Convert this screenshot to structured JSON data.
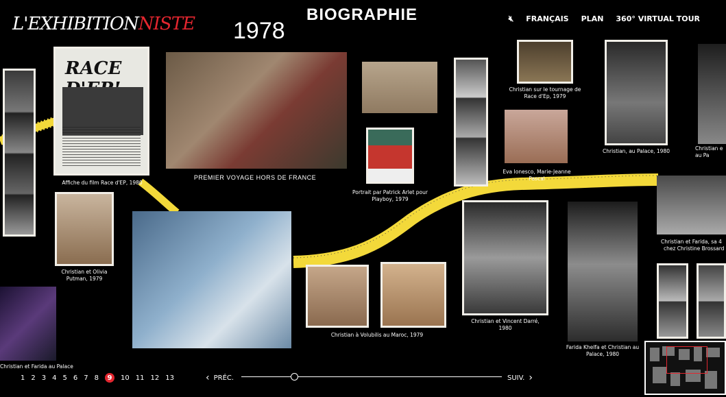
{
  "logo": {
    "text_main": "L'EXHIBITION",
    "text_accent": "NISTE"
  },
  "page_title": "BIOGRAPHIE",
  "year": "1978",
  "nav": {
    "language": "FRANÇAIS",
    "map": "PLAN",
    "virtual_tour": "360° VIRTUAL TOUR",
    "mute_icon": "speaker-mute-icon"
  },
  "poster": {
    "title": "RACE D'EP!"
  },
  "captions": {
    "affiche": "Affiche du film Race d'EP, 1980",
    "premier_voyage": "PREMIER VOYAGE HORS DE FRANCE",
    "portrait_arlet": "Portrait par Patrick Arlet pour Playboy, 1979",
    "tournage": "Christian sur le tournage de Race d'Ep, 1979",
    "palace_1980": "Christian, au Palace, 1980",
    "christian_e": "Christian e au Pa",
    "eva_ionesco": "Eva Ionesco, Marie-Jeanne Pascal",
    "olivia": "Christian et Olivia Putman, 1979",
    "volubilis": "Christian à Volubilis au Maroc, 1979",
    "vincent": "Christian et Vincent Darré, 1980",
    "farida_khelfa": "Farida Khelfa et Christian au Palace, 1980",
    "farida_sa4": "Christian et Farida, sa 4",
    "brossard": "chez Christine Brossard",
    "farida_palace": "Christian et Farida au Palace"
  },
  "pagination": {
    "pages": [
      "1",
      "2",
      "3",
      "4",
      "5",
      "6",
      "7",
      "8",
      "9",
      "10",
      "11",
      "12",
      "13"
    ],
    "active": "9"
  },
  "pager": {
    "prev": "PRÉC.",
    "next": "SUIV."
  },
  "colors": {
    "accent": "#e3262f",
    "tape": "#f3d93a",
    "background": "#000000"
  }
}
